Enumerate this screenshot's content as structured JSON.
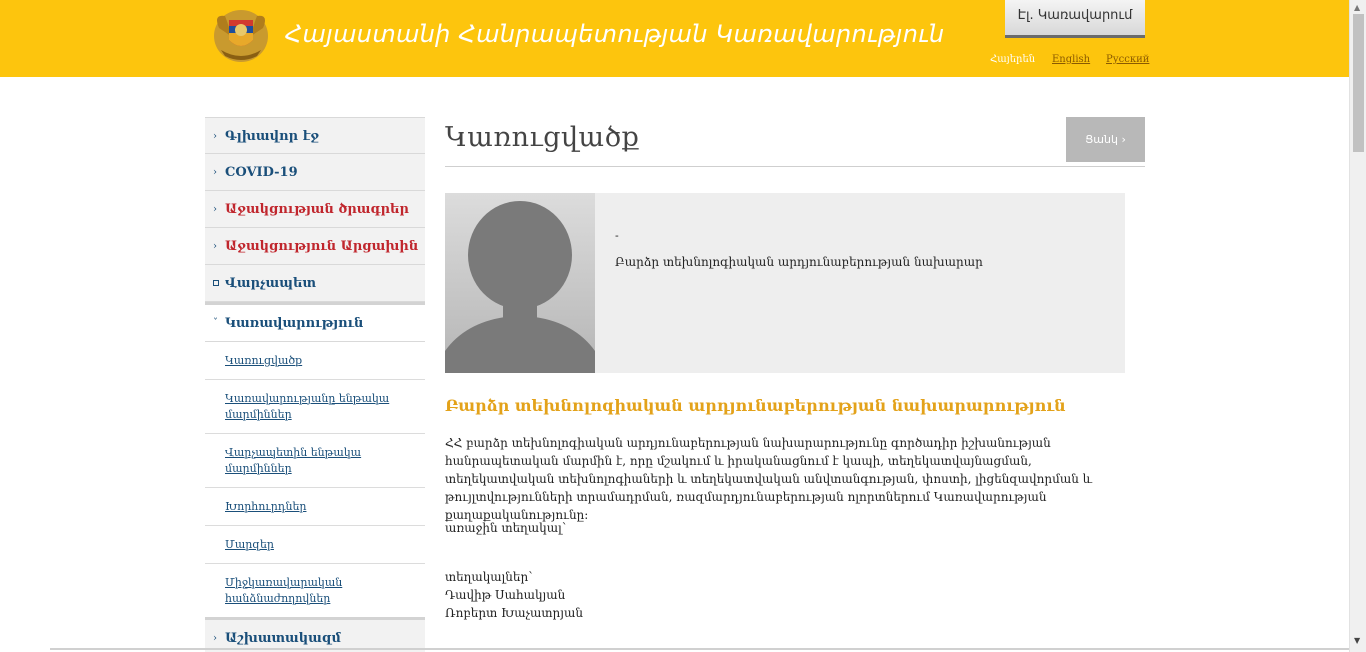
{
  "header": {
    "title": "Հայաստանի Հանրապետության Կառավարություն",
    "egov_label": "Էլ. Կառավարում",
    "langs": {
      "hy": "Հայերեն",
      "en": "English",
      "ru": "Русский"
    }
  },
  "sidebar": {
    "items": [
      {
        "label": "Գլխավոր էջ"
      },
      {
        "label": "COVID-19"
      },
      {
        "label": "Աջակցության ծրագրեր"
      },
      {
        "label": "Աջակցություն Արցախին"
      },
      {
        "label": "Վարչապետ"
      },
      {
        "label": "Կառավարություն"
      }
    ],
    "sub_items": [
      {
        "label": "Կառուցվածք"
      },
      {
        "label": "Կառավարությանը ենթակա մարմիններ"
      },
      {
        "label": "Վարչապետին ենթակա մարմիններ"
      },
      {
        "label": "Խորհուրդներ"
      },
      {
        "label": "Մարզեր"
      },
      {
        "label": "Միջկառավարական հանձնաժողովներ"
      }
    ],
    "after": [
      {
        "label": "Աշխատակազմ"
      }
    ]
  },
  "main": {
    "page_title": "Կառուցվածք",
    "back_label": "Ցանկ ›",
    "card": {
      "name": "-",
      "position": "Բարձր տեխնոլոգիական արդյունաբերության նախարար"
    },
    "ministry_name": "Բարձր տեխնոլոգիական արդյունաբերության նախարարություն",
    "description": "ՀՀ բարձր տեխնոլոգիական արդյունաբերության նախարարությունը գործադիր իշխանության հանրապետական մարմին է, որը մշակում և իրականացնում է կապի, տեղեկատվայնացման, տեղեկատվական տեխնոլոգիաների և տեղեկատվական անվտանգության, փոստի, լիցենզավորման և թույլտվությունների տրամադրման, ռազմարդյունաբերության ոլորտներում Կառավարության քաղաքականությունը:",
    "location_label": "առաջին տեղակալ՝",
    "deputies_label": "տեղակալներ՝",
    "deputies": [
      "Դավիթ Սահակյան",
      "Ռոբերտ Խաչատրյան"
    ]
  }
}
